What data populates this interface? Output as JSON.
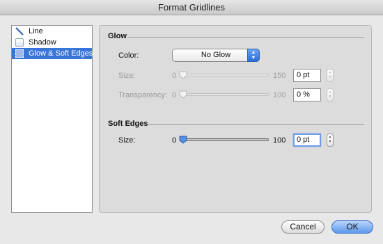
{
  "window": {
    "title": "Format Gridlines"
  },
  "categories": [
    {
      "label": "Line",
      "icon": "line-icon",
      "selected": false
    },
    {
      "label": "Shadow",
      "icon": "shadow-icon",
      "selected": false
    },
    {
      "label": "Glow & Soft Edges",
      "icon": "glow-icon",
      "selected": true
    }
  ],
  "glow": {
    "title": "Glow",
    "color_label": "Color:",
    "color_value": "No Glow",
    "size": {
      "label": "Size:",
      "min": "0",
      "max": "150",
      "value": "0 pt",
      "level": 0
    },
    "transparency": {
      "label": "Transparency:",
      "min": "0",
      "max": "100",
      "value": "0 %",
      "level": 0
    }
  },
  "soft_edges": {
    "title": "Soft Edges",
    "size": {
      "label": "Size:",
      "min": "0",
      "max": "100",
      "value": "0 pt",
      "level": 0
    }
  },
  "buttons": {
    "cancel": "Cancel",
    "ok": "OK"
  },
  "colors": {
    "selection": "#3875d7",
    "default_button": "#5e98ec",
    "slider_thumb_active": "#5b8fe0"
  }
}
